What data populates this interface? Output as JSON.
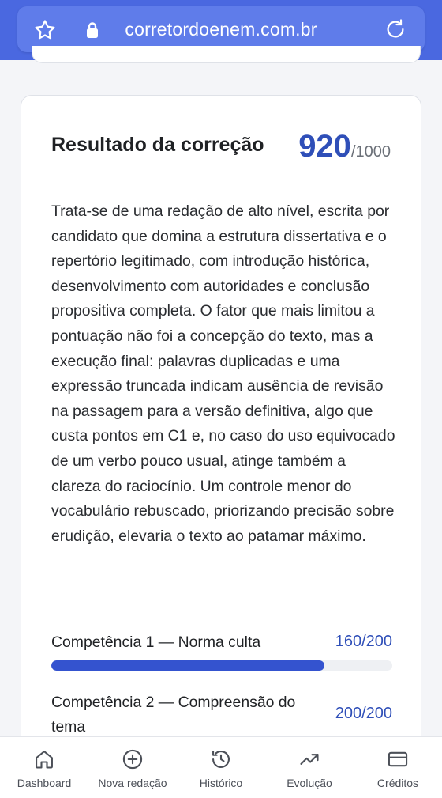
{
  "browser": {
    "url": "corretordoenem.com.br",
    "icons": {
      "bookmark": "star-icon",
      "secure": "lock-icon",
      "reload": "reload-icon"
    }
  },
  "result": {
    "title": "Resultado da correção",
    "score": "920",
    "score_max": "/1000",
    "summary": "Trata-se de uma redação de alto nível, escrita por candidato que domina a estrutura dissertativa e o repertório legitimado, com introdução histórica, desenvolvimento com autoridades e conclusão propositiva completa. O fator que mais limitou a pontuação não foi a concepção do texto, mas a execução final: palavras duplicadas e uma expressão truncada indicam ausência de revisão na passagem para a versão definitiva, algo que custa pontos em C1 e, no caso do uso equivocado de um verbo pouco usual, atinge também a clareza do raciocínio. Um controle menor do vocabulário rebuscado, priorizando precisão sobre erudição, elevaria o texto ao patamar máximo."
  },
  "competencies": [
    {
      "label": "Competência 1 — Norma culta",
      "score": "160/200",
      "fraction": 0.8
    },
    {
      "label": "Competência 2 — Compreensão do tema",
      "score": "200/200",
      "fraction": 1.0
    }
  ],
  "colors": {
    "accent": "#3453cf",
    "header": "#4a68e0",
    "score_text": "#2f4fb8"
  },
  "nav": [
    {
      "label": "Dashboard",
      "icon": "home-icon"
    },
    {
      "label": "Nova redação",
      "icon": "plus-circle-icon"
    },
    {
      "label": "Histórico",
      "icon": "history-icon"
    },
    {
      "label": "Evolução",
      "icon": "trending-up-icon"
    },
    {
      "label": "Créditos",
      "icon": "credit-card-icon"
    }
  ]
}
